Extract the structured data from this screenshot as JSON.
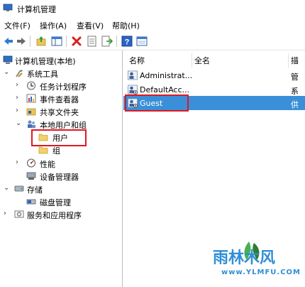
{
  "window": {
    "title": "计算机管理"
  },
  "menu": [
    "文件(F)",
    "操作(A)",
    "查看(V)",
    "帮助(H)"
  ],
  "toolbar": [
    "back-icon",
    "forward-icon",
    "up-folder-icon",
    "show-hide-tree-icon",
    "delete-icon",
    "properties-icon",
    "export-list-icon",
    "help-icon",
    "console-icon"
  ],
  "tree": {
    "root": "计算机管理(本地)",
    "system_tools": "系统工具",
    "task_scheduler": "任务计划程序",
    "event_viewer": "事件查看器",
    "shared_folders": "共享文件夹",
    "local_users_groups": "本地用户和组",
    "users": "用户",
    "groups": "组",
    "performance": "性能",
    "device_manager": "设备管理器",
    "storage": "存储",
    "disk_management": "磁盘管理",
    "services_apps": "服务和应用程序"
  },
  "list": {
    "headers": {
      "name": "名称",
      "fullname": "全名",
      "desc": "描"
    },
    "rows": [
      {
        "name": "Administrat...",
        "desc": "管"
      },
      {
        "name": "DefaultAcc...",
        "desc": "系"
      },
      {
        "name": "Guest",
        "desc": "供"
      }
    ]
  },
  "watermark": {
    "brand": "雨林木风",
    "url": "www.YLMFU.COM"
  },
  "colors": {
    "selection": "#3a8fd8",
    "highlight_box": "#e0181f",
    "accent": "#0078d7"
  }
}
